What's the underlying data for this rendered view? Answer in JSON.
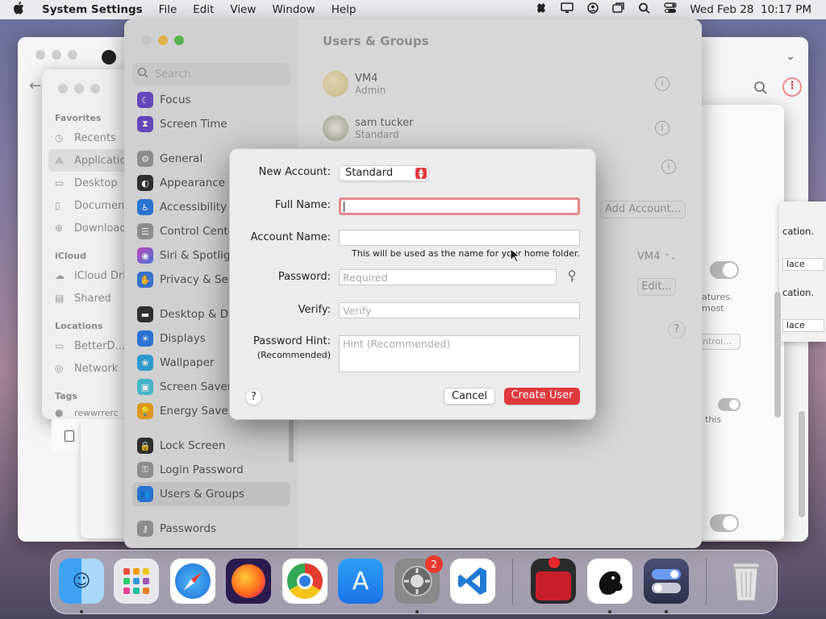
{
  "menubar": {
    "app_name": "System Settings",
    "items": [
      "File",
      "Edit",
      "View",
      "Window",
      "Help"
    ],
    "datetime": "Wed Feb 28  10:17 PM"
  },
  "finder": {
    "favorites_header": "Favorites",
    "favorites": [
      "Recents",
      "Applicatio",
      "Desktop",
      "Document",
      "Download"
    ],
    "icloud_header": "iCloud",
    "icloud": [
      "iCloud Driv",
      "Shared"
    ],
    "locations_header": "Locations",
    "locations": [
      "BetterD...",
      "Network"
    ],
    "tags_header": "Tags",
    "tag_partial": "rewwrrerc"
  },
  "settings": {
    "title": "Users & Groups",
    "search_placeholder": "Search",
    "sidebar": [
      "Focus",
      "Screen Time",
      "General",
      "Appearance",
      "Accessibility",
      "Control Center",
      "Siri & Spotlight",
      "Privacy & Secu",
      "Desktop & Doc",
      "Displays",
      "Wallpaper",
      "Screen Saver",
      "Energy Saver",
      "Lock Screen",
      "Login Password",
      "Users & Groups",
      "Passwords"
    ],
    "users": [
      {
        "name": "VM4",
        "role": "Admin"
      },
      {
        "name": "sam tucker",
        "role": "Standard"
      }
    ],
    "add_account": "Add Account...",
    "auto_login_value": "VM4",
    "edit_button": "Edit...",
    "help": "?"
  },
  "right_window": {
    "text1": "cation.",
    "place1": "lace",
    "text2": "cation.",
    "place2": "lace",
    "features": "atures.",
    "most": "most",
    "control": "ntrol...",
    "this": "this"
  },
  "dialog": {
    "new_account_label": "New Account:",
    "new_account_value": "Standard",
    "full_name_label": "Full Name:",
    "full_name_value": "",
    "account_name_label": "Account Name:",
    "account_name_hint": "This will be used as the name for your home folder.",
    "password_label": "Password:",
    "password_placeholder": "Required",
    "verify_label": "Verify:",
    "verify_placeholder": "Verify",
    "hint_label": "Password Hint:",
    "hint_sublabel": "(Recommended)",
    "hint_placeholder": "Hint (Recommended)",
    "help": "?",
    "cancel": "Cancel",
    "create": "Create User"
  },
  "dock": {
    "settings_badge": "2"
  },
  "colors": {
    "accent": "#e0393e",
    "focus_ring": "#e68a8c"
  }
}
